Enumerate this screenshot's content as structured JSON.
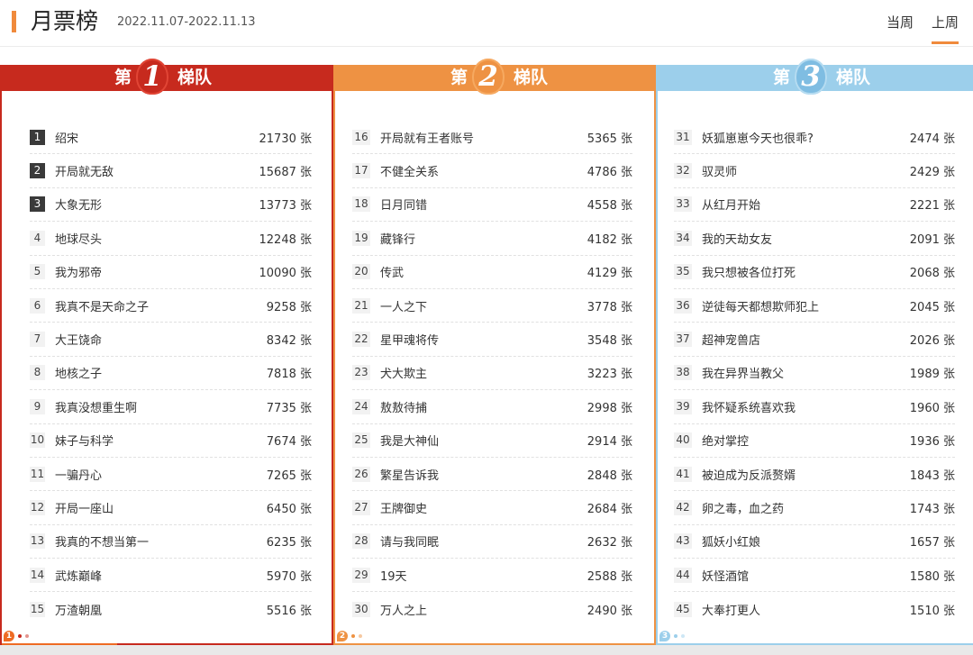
{
  "header": {
    "title": "月票榜",
    "date_range": "2022.11.07-2022.11.13",
    "tabs": [
      {
        "label": "当周",
        "active": false
      },
      {
        "label": "上周",
        "active": true
      }
    ]
  },
  "colors": {
    "accent": "#f08a3c",
    "tier1": "#c72a1e",
    "tier2": "#ee9243",
    "tier3": "#9ccfeb"
  },
  "tiers": [
    {
      "prefix": "第",
      "number": "1",
      "suffix": "梯队",
      "page": "1",
      "rows": [
        {
          "rank": "1",
          "name": "绍宋",
          "votes": "21730 张"
        },
        {
          "rank": "2",
          "name": "开局就无敌",
          "votes": "15687 张"
        },
        {
          "rank": "3",
          "name": "大象无形",
          "votes": "13773 张"
        },
        {
          "rank": "4",
          "name": "地球尽头",
          "votes": "12248 张"
        },
        {
          "rank": "5",
          "name": "我为邪帝",
          "votes": "10090 张"
        },
        {
          "rank": "6",
          "name": "我真不是天命之子",
          "votes": "9258 张"
        },
        {
          "rank": "7",
          "name": "大王饶命",
          "votes": "8342 张"
        },
        {
          "rank": "8",
          "name": "地核之子",
          "votes": "7818 张"
        },
        {
          "rank": "9",
          "name": "我真没想重生啊",
          "votes": "7735 张"
        },
        {
          "rank": "10",
          "name": "妹子与科学",
          "votes": "7674 张"
        },
        {
          "rank": "11",
          "name": "一骗丹心",
          "votes": "7265 张"
        },
        {
          "rank": "12",
          "name": "开局一座山",
          "votes": "6450 张"
        },
        {
          "rank": "13",
          "name": "我真的不想当第一",
          "votes": "6235 张"
        },
        {
          "rank": "14",
          "name": "武炼巅峰",
          "votes": "5970 张"
        },
        {
          "rank": "15",
          "name": "万渣朝凰",
          "votes": "5516 张"
        }
      ]
    },
    {
      "prefix": "第",
      "number": "2",
      "suffix": "梯队",
      "page": "2",
      "rows": [
        {
          "rank": "16",
          "name": "开局就有王者账号",
          "votes": "5365 张"
        },
        {
          "rank": "17",
          "name": "不健全关系",
          "votes": "4786 张"
        },
        {
          "rank": "18",
          "name": "日月同错",
          "votes": "4558 张"
        },
        {
          "rank": "19",
          "name": "藏锋行",
          "votes": "4182 张"
        },
        {
          "rank": "20",
          "name": "传武",
          "votes": "4129 张"
        },
        {
          "rank": "21",
          "name": "一人之下",
          "votes": "3778 张"
        },
        {
          "rank": "22",
          "name": "星甲魂将传",
          "votes": "3548 张"
        },
        {
          "rank": "23",
          "name": "犬大欺主",
          "votes": "3223 张"
        },
        {
          "rank": "24",
          "name": "敖敖待捕",
          "votes": "2998 张"
        },
        {
          "rank": "25",
          "name": "我是大神仙",
          "votes": "2914 张"
        },
        {
          "rank": "26",
          "name": "繁星告诉我",
          "votes": "2848 张"
        },
        {
          "rank": "27",
          "name": "王牌御史",
          "votes": "2684 张"
        },
        {
          "rank": "28",
          "name": "请与我同眠",
          "votes": "2632 张"
        },
        {
          "rank": "29",
          "name": "19天",
          "votes": "2588 张"
        },
        {
          "rank": "30",
          "name": "万人之上",
          "votes": "2490 张"
        }
      ]
    },
    {
      "prefix": "第",
      "number": "3",
      "suffix": "梯队",
      "page": "3",
      "rows": [
        {
          "rank": "31",
          "name": "妖狐崽崽今天也很乖?",
          "votes": "2474 张"
        },
        {
          "rank": "32",
          "name": "驭灵师",
          "votes": "2429 张"
        },
        {
          "rank": "33",
          "name": "从红月开始",
          "votes": "2221 张"
        },
        {
          "rank": "34",
          "name": "我的天劫女友",
          "votes": "2091 张"
        },
        {
          "rank": "35",
          "name": "我只想被各位打死",
          "votes": "2068 张"
        },
        {
          "rank": "36",
          "name": "逆徒每天都想欺师犯上",
          "votes": "2045 张"
        },
        {
          "rank": "37",
          "name": "超神宠兽店",
          "votes": "2026 张"
        },
        {
          "rank": "38",
          "name": "我在异界当教父",
          "votes": "1989 张"
        },
        {
          "rank": "39",
          "name": "我怀疑系统喜欢我",
          "votes": "1960 张"
        },
        {
          "rank": "40",
          "name": "绝对掌控",
          "votes": "1936 张"
        },
        {
          "rank": "41",
          "name": "被迫成为反派赘婿",
          "votes": "1843 张"
        },
        {
          "rank": "42",
          "name": "卵之毒，血之药",
          "votes": "1743 张"
        },
        {
          "rank": "43",
          "name": "狐妖小红娘",
          "votes": "1657 张"
        },
        {
          "rank": "44",
          "name": "妖怪酒馆",
          "votes": "1580 张"
        },
        {
          "rank": "45",
          "name": "大奉打更人",
          "votes": "1510 张"
        }
      ]
    }
  ]
}
